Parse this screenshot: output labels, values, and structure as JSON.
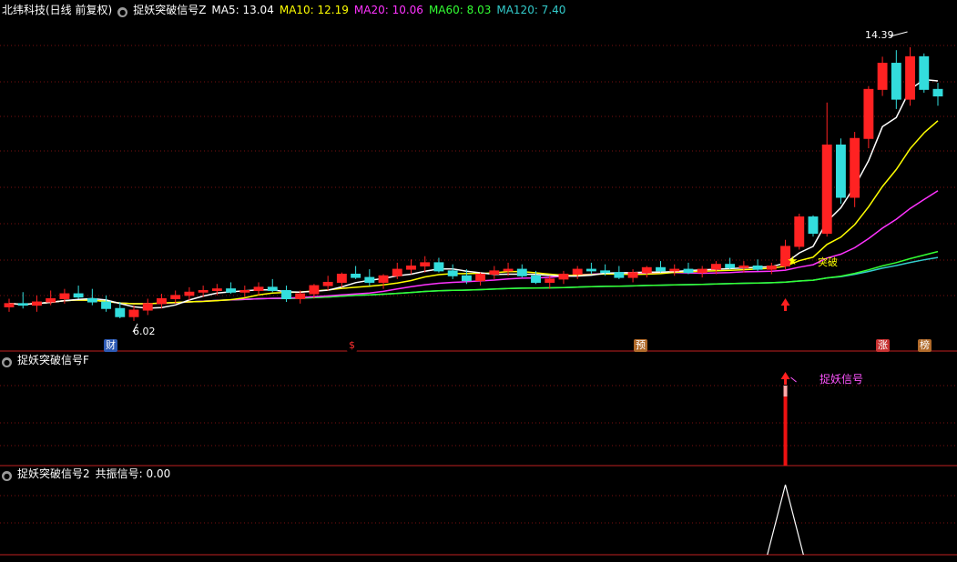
{
  "panel1": {
    "stock": "北纬科技(日线 前复权)",
    "indicator": "捉妖突破信号Z",
    "ma": [
      {
        "label": "MA5: 13.04",
        "color": "#ffffff"
      },
      {
        "label": "MA10: 12.19",
        "color": "#ffff00"
      },
      {
        "label": "MA20: 10.06",
        "color": "#ff33ff"
      },
      {
        "label": "MA60: 8.03",
        "color": "#33ff33"
      },
      {
        "label": "MA120: 7.40",
        "color": "#33cccc"
      }
    ],
    "high_label": "14.39",
    "low_label": "6.02",
    "breakout_label": "突破",
    "badges": [
      {
        "text": "财",
        "bg": "#2d5ab4"
      },
      {
        "text": "$",
        "bg": "#000000",
        "fg": "#ff3030"
      },
      {
        "text": "预",
        "bg": "#b06a2a"
      },
      {
        "text": "涨",
        "bg": "#c83232"
      },
      {
        "text": "榜",
        "bg": "#b06a2a"
      }
    ]
  },
  "panel2": {
    "indicator": "捉妖突破信号F",
    "signal_label": "捉妖信号"
  },
  "panel3": {
    "indicator": "捉妖突破信号2",
    "value_label": "共振信号: 0.00"
  },
  "chart_data": [
    {
      "type": "candlestick",
      "title": "北纬科技(日线 前复权)",
      "y_range": [
        5.6,
        15.0
      ],
      "ohlc": [
        [
          6.45,
          6.7,
          6.3,
          6.55
        ],
        [
          6.55,
          6.9,
          6.4,
          6.5
        ],
        [
          6.5,
          6.8,
          6.3,
          6.6
        ],
        [
          6.6,
          6.95,
          6.5,
          6.7
        ],
        [
          6.7,
          7.0,
          6.55,
          6.85
        ],
        [
          6.85,
          7.1,
          6.7,
          6.75
        ],
        [
          6.7,
          7.0,
          6.5,
          6.6
        ],
        [
          6.6,
          6.8,
          6.3,
          6.4
        ],
        [
          6.4,
          6.6,
          6.1,
          6.15
        ],
        [
          6.15,
          6.5,
          6.02,
          6.35
        ],
        [
          6.35,
          6.7,
          6.2,
          6.55
        ],
        [
          6.55,
          6.85,
          6.4,
          6.7
        ],
        [
          6.7,
          6.95,
          6.55,
          6.8
        ],
        [
          6.8,
          7.05,
          6.65,
          6.9
        ],
        [
          6.9,
          7.1,
          6.75,
          6.95
        ],
        [
          6.95,
          7.15,
          6.8,
          7.0
        ],
        [
          7.0,
          7.2,
          6.85,
          6.9
        ],
        [
          6.9,
          7.1,
          6.75,
          6.95
        ],
        [
          6.95,
          7.2,
          6.8,
          7.05
        ],
        [
          7.05,
          7.3,
          6.9,
          6.95
        ],
        [
          6.95,
          7.1,
          6.6,
          6.7
        ],
        [
          6.7,
          6.95,
          6.55,
          6.85
        ],
        [
          6.85,
          7.15,
          6.7,
          7.1
        ],
        [
          7.1,
          7.4,
          6.95,
          7.2
        ],
        [
          7.2,
          7.5,
          7.05,
          7.45
        ],
        [
          7.45,
          7.7,
          7.3,
          7.35
        ],
        [
          7.35,
          7.6,
          7.1,
          7.2
        ],
        [
          7.2,
          7.45,
          7.0,
          7.4
        ],
        [
          7.4,
          7.8,
          7.3,
          7.6
        ],
        [
          7.6,
          7.9,
          7.45,
          7.7
        ],
        [
          7.7,
          8.0,
          7.5,
          7.8
        ],
        [
          7.8,
          7.95,
          7.5,
          7.55
        ],
        [
          7.55,
          7.75,
          7.3,
          7.4
        ],
        [
          7.4,
          7.6,
          7.15,
          7.25
        ],
        [
          7.25,
          7.5,
          7.1,
          7.45
        ],
        [
          7.45,
          7.7,
          7.3,
          7.55
        ],
        [
          7.55,
          7.8,
          7.4,
          7.6
        ],
        [
          7.6,
          7.75,
          7.35,
          7.4
        ],
        [
          7.4,
          7.55,
          7.15,
          7.2
        ],
        [
          7.2,
          7.4,
          7.0,
          7.3
        ],
        [
          7.3,
          7.55,
          7.15,
          7.45
        ],
        [
          7.45,
          7.7,
          7.3,
          7.6
        ],
        [
          7.6,
          7.8,
          7.45,
          7.55
        ],
        [
          7.55,
          7.75,
          7.4,
          7.5
        ],
        [
          7.5,
          7.7,
          7.3,
          7.35
        ],
        [
          7.35,
          7.6,
          7.2,
          7.5
        ],
        [
          7.5,
          7.7,
          7.35,
          7.65
        ],
        [
          7.65,
          7.85,
          7.5,
          7.55
        ],
        [
          7.55,
          7.75,
          7.4,
          7.6
        ],
        [
          7.6,
          7.8,
          7.45,
          7.5
        ],
        [
          7.5,
          7.7,
          7.35,
          7.6
        ],
        [
          7.6,
          7.85,
          7.45,
          7.75
        ],
        [
          7.75,
          7.95,
          7.6,
          7.65
        ],
        [
          7.65,
          7.85,
          7.5,
          7.7
        ],
        [
          7.7,
          7.9,
          7.55,
          7.6
        ],
        [
          7.6,
          7.8,
          7.45,
          7.7
        ],
        [
          7.7,
          8.5,
          7.6,
          8.3
        ],
        [
          8.3,
          9.3,
          8.2,
          9.2
        ],
        [
          9.2,
          9.25,
          8.6,
          8.7
        ],
        [
          8.7,
          12.7,
          8.6,
          11.4
        ],
        [
          11.4,
          11.6,
          9.6,
          9.8
        ],
        [
          9.8,
          11.8,
          9.5,
          11.6
        ],
        [
          11.6,
          13.2,
          11.3,
          13.1
        ],
        [
          13.1,
          14.1,
          12.9,
          13.9
        ],
        [
          13.9,
          14.3,
          12.5,
          12.8
        ],
        [
          12.8,
          14.39,
          12.6,
          14.1
        ],
        [
          14.1,
          14.2,
          13.0,
          13.1
        ],
        [
          13.1,
          13.3,
          12.6,
          12.9
        ]
      ],
      "ma": {
        "MA5": 13.04,
        "MA10": 12.19,
        "MA20": 10.06,
        "MA60": 8.03,
        "MA120": 7.4
      },
      "annotations": [
        "14.39",
        "6.02",
        "突破"
      ]
    },
    {
      "type": "bar",
      "title": "捉妖突破信号F",
      "signal_index": 56,
      "signal_value": 1,
      "annotations": [
        "捉妖信号"
      ]
    },
    {
      "type": "line",
      "title": "捉妖突破信号2",
      "series": [
        {
          "name": "共振信号",
          "spike_index": 56,
          "peak": 1,
          "current": 0.0
        }
      ]
    }
  ]
}
